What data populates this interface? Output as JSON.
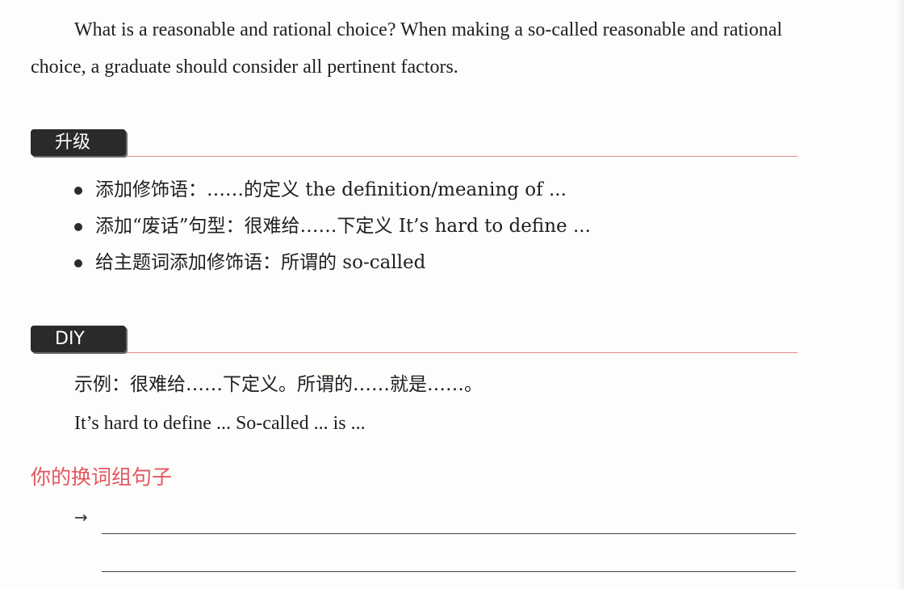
{
  "intro_paragraph": "What is a reasonable and rational choice? When making a so-called reasonable and rational choice, a graduate should consider all pertinent factors.",
  "upgrade_section": {
    "tag": "升级",
    "items": [
      "添加修饰语：……的定义 the definition/meaning of ...",
      "添加“废话”句型：很难给……下定义 It’s hard to define ...",
      "给主题词添加修饰语：所谓的 so-called"
    ]
  },
  "diy_section": {
    "tag": "DIY",
    "example_zh": "示例：很难给……下定义。所谓的……就是……。",
    "example_en": "It’s hard to define ... So-called ... is ..."
  },
  "your_sentence": {
    "title": "你的换词组句子",
    "arrow": "→"
  }
}
